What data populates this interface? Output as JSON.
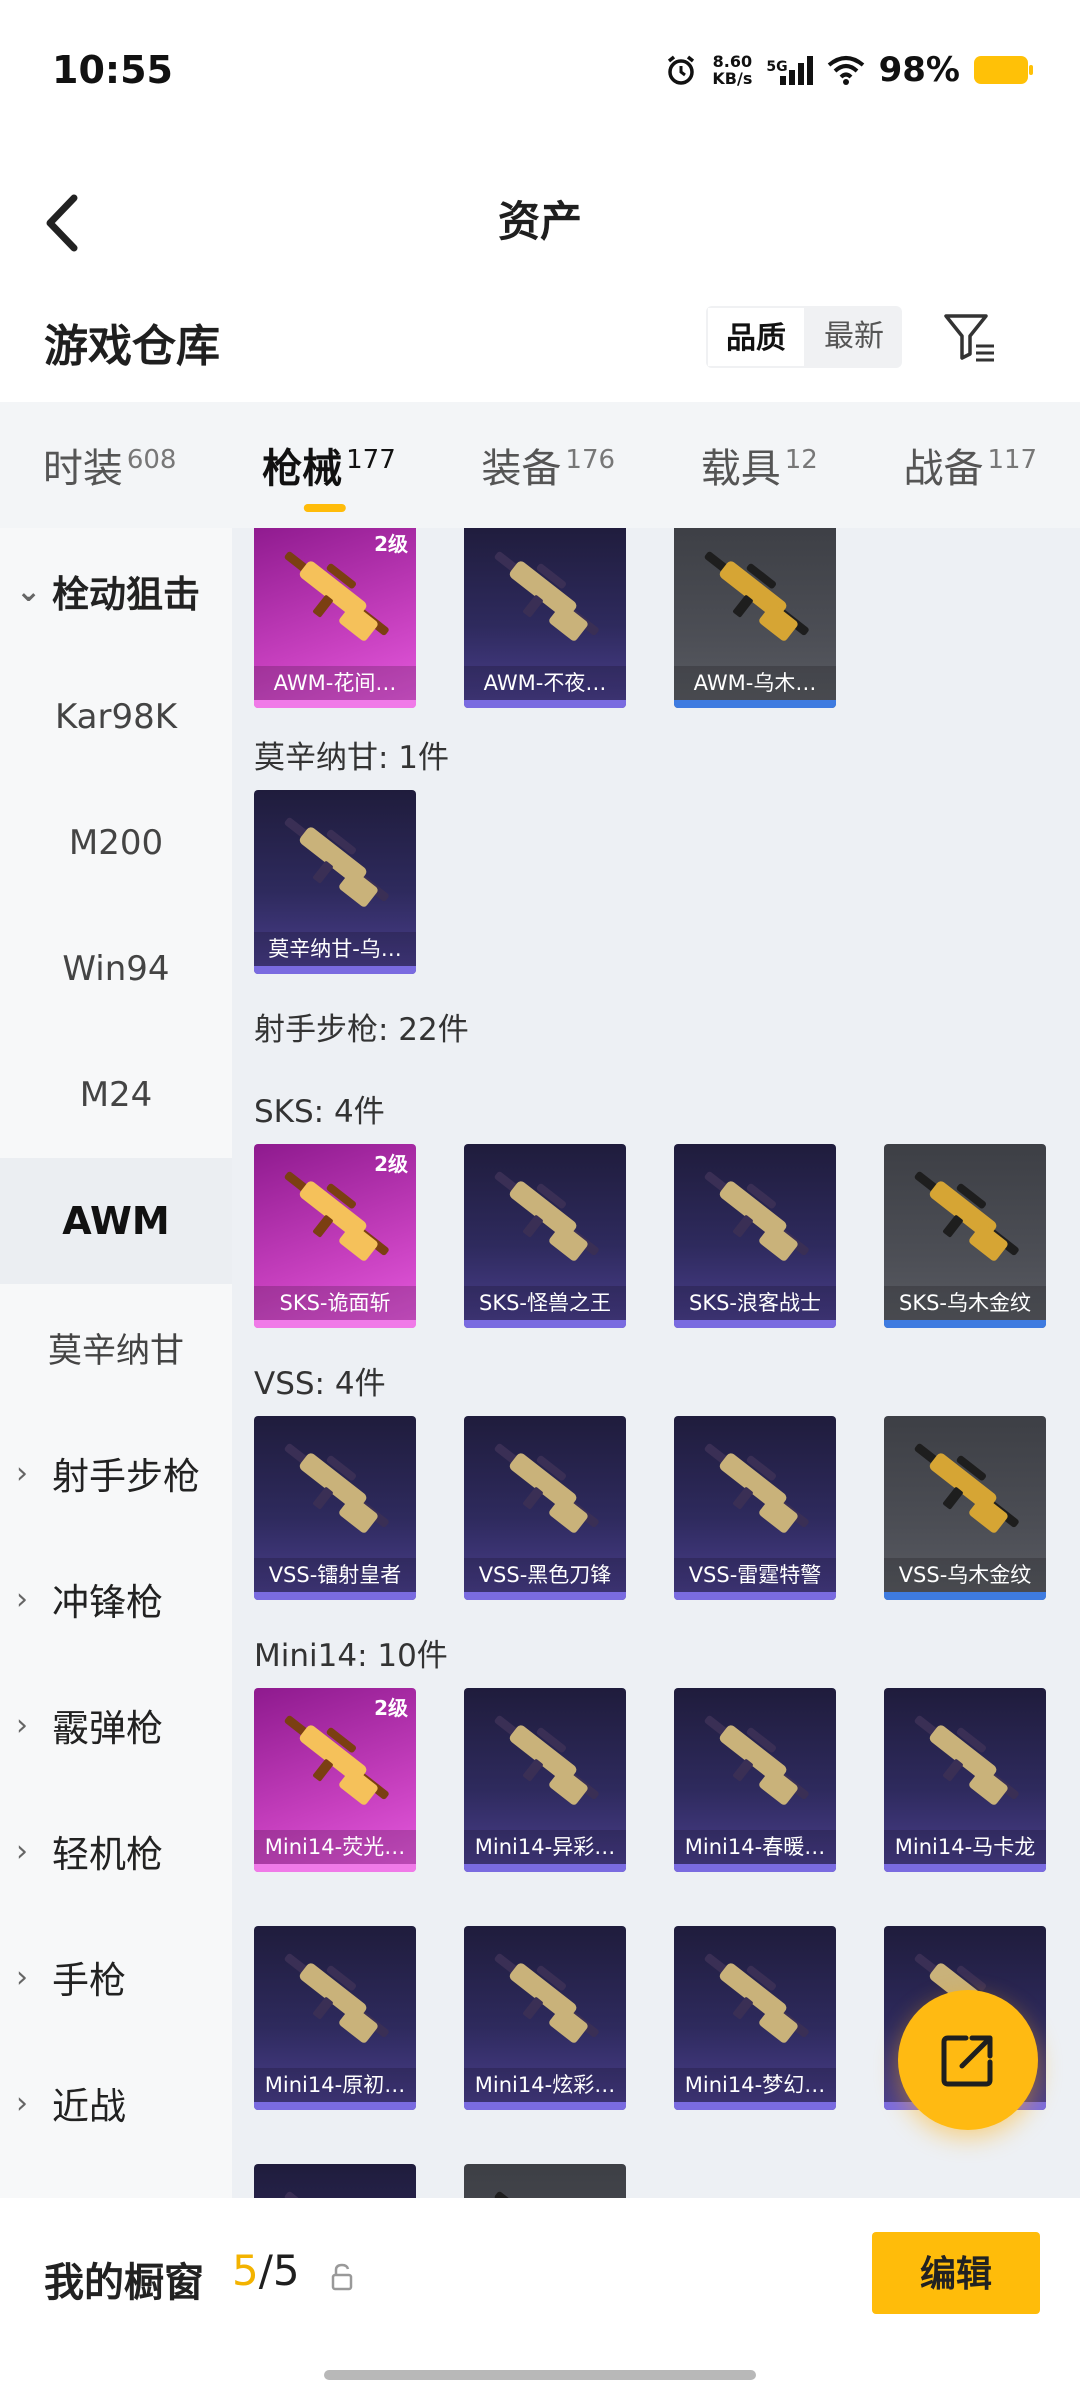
{
  "status_bar": {
    "time": "10:55",
    "net_speed_value": "8.60",
    "net_speed_unit": "KB/s",
    "network_type": "5G",
    "battery_percent": "98%",
    "battery_color": "#ffc107"
  },
  "header": {
    "title": "资产",
    "back_icon": "chevron-left-icon"
  },
  "section": {
    "title": "游戏仓库",
    "sort_options": [
      "品质",
      "最新"
    ],
    "sort_selected": "品质",
    "filter_icon": "filter-icon"
  },
  "tabs": [
    {
      "label": "时装",
      "count": "608"
    },
    {
      "label": "枪械",
      "count": "177",
      "active": true
    },
    {
      "label": "装备",
      "count": "176"
    },
    {
      "label": "载具",
      "count": "12"
    },
    {
      "label": "战备",
      "count": "117"
    }
  ],
  "sidebar": {
    "items": [
      {
        "label": "栓动狙击",
        "type": "group",
        "expanded": true
      },
      {
        "label": "Kar98K",
        "type": "sub"
      },
      {
        "label": "M200",
        "type": "sub"
      },
      {
        "label": "Win94",
        "type": "sub"
      },
      {
        "label": "M24",
        "type": "sub"
      },
      {
        "label": "AWM",
        "type": "sub",
        "selected": true
      },
      {
        "label": "莫辛纳甘",
        "type": "sub"
      },
      {
        "label": "射手步枪",
        "type": "group"
      },
      {
        "label": "冲锋枪",
        "type": "group"
      },
      {
        "label": "霰弹枪",
        "type": "group"
      },
      {
        "label": "轻机枪",
        "type": "group"
      },
      {
        "label": "手枪",
        "type": "group"
      },
      {
        "label": "近战",
        "type": "group"
      }
    ]
  },
  "content": {
    "labels": {
      "mosin": "莫辛纳甘: 1件",
      "dmr": "射手步枪: 22件",
      "sks": "SKS: 4件",
      "vss": "VSS: 4件",
      "mini14": "Mini14: 10件"
    },
    "level_badge": "2级",
    "awm_items": [
      {
        "name": "AWM-花间…",
        "tier": "pink",
        "level": true
      },
      {
        "name": "AWM-不夜…",
        "tier": "purple"
      },
      {
        "name": "AWM-乌木…",
        "tier": "gray"
      }
    ],
    "mosin_items": [
      {
        "name": "莫辛纳甘-乌…",
        "tier": "purple"
      }
    ],
    "sks_items": [
      {
        "name": "SKS-诡面斩",
        "tier": "pink",
        "level": true
      },
      {
        "name": "SKS-怪兽之王",
        "tier": "purple"
      },
      {
        "name": "SKS-浪客战士",
        "tier": "purple"
      },
      {
        "name": "SKS-乌木金纹",
        "tier": "gray"
      }
    ],
    "vss_items": [
      {
        "name": "VSS-镭射皇者",
        "tier": "purple"
      },
      {
        "name": "VSS-黑色刀锋",
        "tier": "purple"
      },
      {
        "name": "VSS-雷霆特警",
        "tier": "purple"
      },
      {
        "name": "VSS-乌木金纹",
        "tier": "gray"
      }
    ],
    "mini14_items": [
      {
        "name": "Mini14-荧光…",
        "tier": "pink",
        "level": true
      },
      {
        "name": "Mini14-异彩…",
        "tier": "purple"
      },
      {
        "name": "Mini14-春暖…",
        "tier": "purple"
      },
      {
        "name": "Mini14-马卡龙",
        "tier": "purple"
      },
      {
        "name": "Mini14-原初…",
        "tier": "purple"
      },
      {
        "name": "Mini14-炫彩…",
        "tier": "purple"
      },
      {
        "name": "Mini14-梦幻…",
        "tier": "purple"
      },
      {
        "name": "",
        "tier": "purple"
      },
      {
        "name": "",
        "tier": "purple"
      },
      {
        "name": "",
        "tier": "gray"
      }
    ]
  },
  "fab": {
    "icon": "share-icon",
    "color": "#ffba12"
  },
  "bottom_bar": {
    "showcase_label": "我的橱窗",
    "showcase_current": "5",
    "showcase_total": "/5",
    "lock_icon": "lock-icon",
    "edit_label": "编辑"
  },
  "accent_color": "#ffbc0a"
}
